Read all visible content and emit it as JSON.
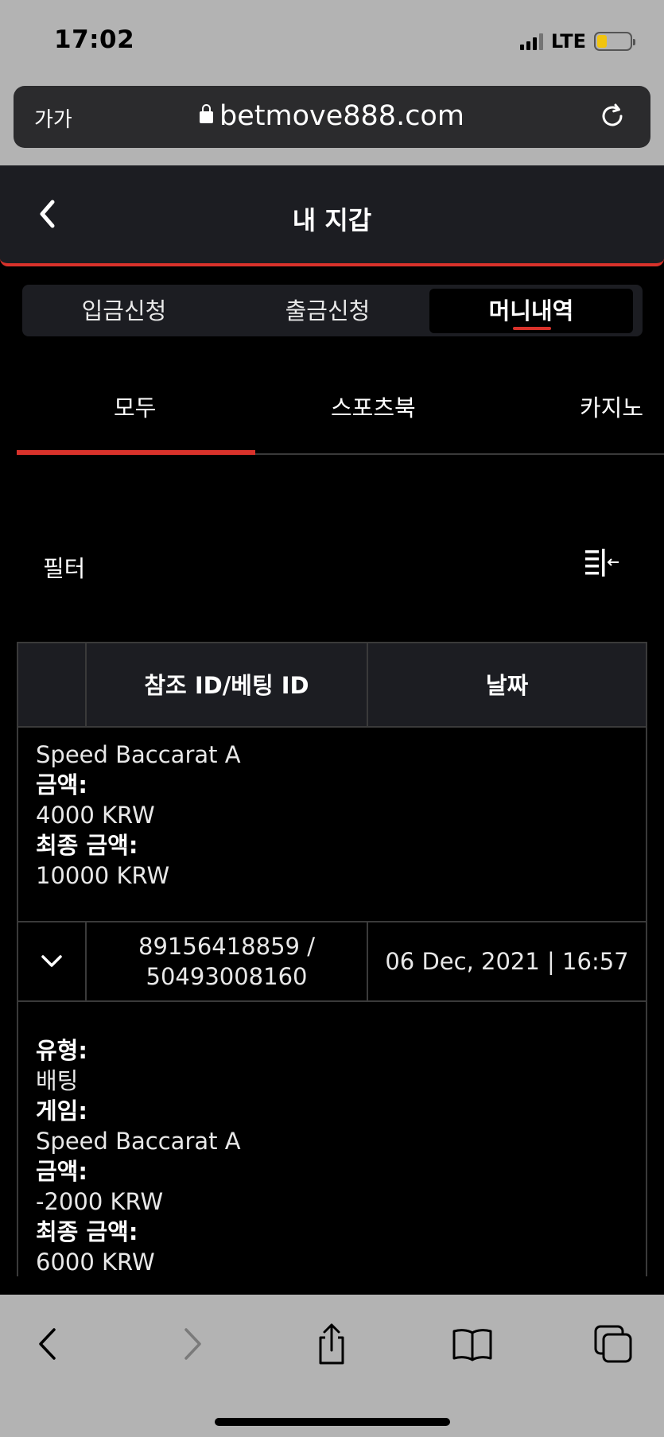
{
  "status_bar": {
    "time": "17:02",
    "network": "LTE",
    "battery_level": 0.3
  },
  "browser": {
    "text_size_label": "가가",
    "url": "betmove888.com"
  },
  "header": {
    "title": "내 지갑"
  },
  "segments": [
    {
      "label": "입금신청",
      "active": false
    },
    {
      "label": "출금신청",
      "active": false
    },
    {
      "label": "머니내역",
      "active": true
    }
  ],
  "categories": [
    {
      "label": "모두",
      "active": true
    },
    {
      "label": "스포츠북",
      "active": false
    },
    {
      "label": "카지노",
      "active": false
    }
  ],
  "filter": {
    "label": "필터"
  },
  "table": {
    "headers": [
      "참조 ID/베팅 ID",
      "날짜"
    ],
    "partial_detail": [
      {
        "key": "게임:",
        "value": "Speed Baccarat A"
      },
      {
        "key": "금액:",
        "value": "4000 KRW"
      },
      {
        "key": "최종 금액:",
        "value": "10000 KRW"
      }
    ],
    "row": {
      "ref_id": "89156418859 /",
      "bet_id": "50493008160",
      "date": "06 Dec, 2021 | 16:57"
    },
    "detail": [
      {
        "key": "유형:",
        "value": "배팅"
      },
      {
        "key": "게임:",
        "value": "Speed Baccarat A"
      },
      {
        "key": "금액:",
        "value": "-2000 KRW"
      },
      {
        "key": "최종 금액:",
        "value": "6000 KRW"
      }
    ]
  },
  "colors": {
    "accent": "#d9322b",
    "panel": "#1c1d22",
    "chrome": "#b3b3b3"
  }
}
